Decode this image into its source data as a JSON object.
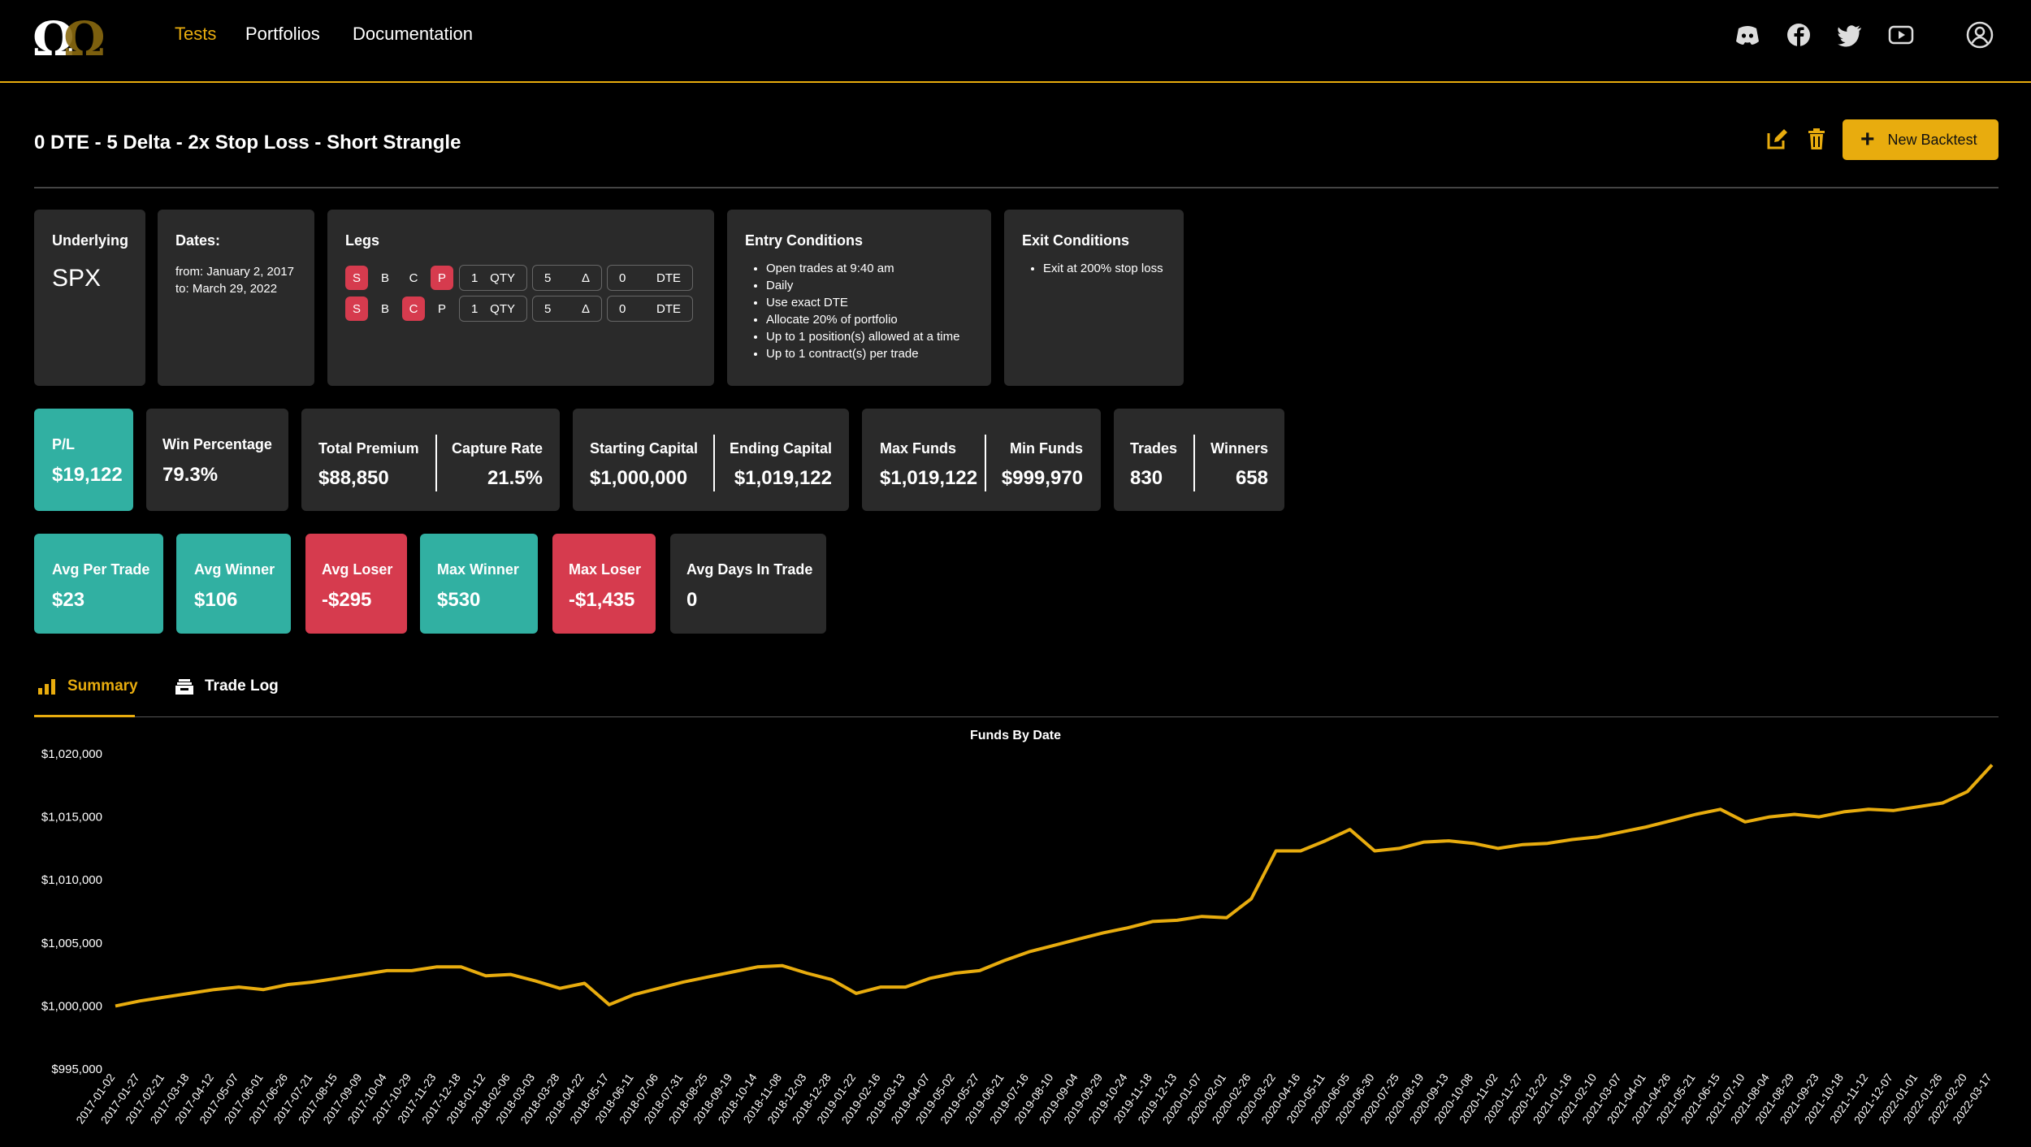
{
  "nav": {
    "links": [
      {
        "label": "Tests",
        "active": true
      },
      {
        "label": "Portfolios",
        "active": false
      },
      {
        "label": "Documentation",
        "active": false
      }
    ],
    "social_icons": [
      "discord-icon",
      "facebook-icon",
      "twitter-icon",
      "youtube-icon",
      "user-account-icon"
    ],
    "accent_color": "#e8ac0e"
  },
  "header": {
    "title": "0 DTE - 5 Delta - 2x Stop Loss - Short Strangle",
    "new_backtest_label": "New Backtest"
  },
  "info": {
    "underlying": {
      "title": "Underlying",
      "value": "SPX"
    },
    "dates": {
      "title": "Dates:",
      "from": "from: January 2, 2017",
      "to": "to: March 29, 2022"
    },
    "legs": {
      "title": "Legs",
      "rows": [
        {
          "s": "S",
          "b": "B",
          "c": "C",
          "p": "P",
          "active_side": "S",
          "active_type": "P",
          "qty": "1",
          "qty_label": "QTY",
          "delta": "5",
          "delta_label": "Δ",
          "dte": "0",
          "dte_label": "DTE"
        },
        {
          "s": "S",
          "b": "B",
          "c": "C",
          "p": "P",
          "active_side": "S",
          "active_type": "C",
          "qty": "1",
          "qty_label": "QTY",
          "delta": "5",
          "delta_label": "Δ",
          "dte": "0",
          "dte_label": "DTE"
        }
      ]
    },
    "entry": {
      "title": "Entry Conditions",
      "items": [
        "Open trades at 9:40 am",
        "Daily",
        "Use exact DTE",
        "Allocate 20% of portfolio",
        "Up to 1 position(s) allowed at a time",
        "Up to 1 contract(s) per trade"
      ]
    },
    "exit": {
      "title": "Exit Conditions",
      "items": [
        "Exit at 200% stop loss"
      ]
    }
  },
  "stats": {
    "pl": {
      "label": "P/L",
      "value": "$19,122"
    },
    "win_pct": {
      "label": "Win Percentage",
      "value": "79.3%"
    },
    "total_premium": {
      "label": "Total Premium",
      "value": "$88,850"
    },
    "capture_rate": {
      "label": "Capture Rate",
      "value": "21.5%"
    },
    "starting_capital": {
      "label": "Starting Capital",
      "value": "$1,000,000"
    },
    "ending_capital": {
      "label": "Ending Capital",
      "value": "$1,019,122"
    },
    "max_funds": {
      "label": "Max Funds",
      "value": "$1,019,122"
    },
    "min_funds": {
      "label": "Min Funds",
      "value": "$999,970"
    },
    "trades": {
      "label": "Trades",
      "value": "830"
    },
    "winners": {
      "label": "Winners",
      "value": "658"
    },
    "avg_per_trade": {
      "label": "Avg Per Trade",
      "value": "$23"
    },
    "avg_winner": {
      "label": "Avg Winner",
      "value": "$106"
    },
    "avg_loser": {
      "label": "Avg Loser",
      "value": "-$295"
    },
    "max_winner": {
      "label": "Max Winner",
      "value": "$530"
    },
    "max_loser": {
      "label": "Max Loser",
      "value": "-$1,435"
    },
    "avg_days": {
      "label": "Avg Days In Trade",
      "value": "0"
    },
    "colors": {
      "positive": "#31b0a2",
      "negative": "#d63b4e",
      "neutral": "#2a2a2a"
    }
  },
  "tabs": [
    {
      "label": "Summary",
      "icon": "bar-chart-icon",
      "active": true
    },
    {
      "label": "Trade Log",
      "icon": "inbox-tray-icon",
      "active": false
    }
  ],
  "chart_data": {
    "type": "line",
    "title": "Funds By Date",
    "xlabel": "",
    "ylabel": "",
    "ylim": [
      995000,
      1020000
    ],
    "y_ticks": [
      "$1,020,000",
      "$1,015,000",
      "$1,010,000",
      "$1,005,000",
      "$1,000,000",
      "$995,000"
    ],
    "y_tick_values": [
      1020000,
      1015000,
      1010000,
      1005000,
      1000000,
      995000
    ],
    "x_ticks": [
      "2017-01-02",
      "2017-01-27",
      "2017-02-21",
      "2017-03-18",
      "2017-04-12",
      "2017-05-07",
      "2017-06-01",
      "2017-06-26",
      "2017-07-21",
      "2017-08-15",
      "2017-09-09",
      "2017-10-04",
      "2017-10-29",
      "2017-11-23",
      "2017-12-18",
      "2018-01-12",
      "2018-02-06",
      "2018-03-03",
      "2018-03-28",
      "2018-04-22",
      "2018-05-17",
      "2018-06-11",
      "2018-07-06",
      "2018-07-31",
      "2018-08-25",
      "2018-09-19",
      "2018-10-14",
      "2018-11-08",
      "2018-12-03",
      "2018-12-28",
      "2019-01-22",
      "2019-02-16",
      "2019-03-13",
      "2019-04-07",
      "2019-05-02",
      "2019-05-27",
      "2019-06-21",
      "2019-07-16",
      "2019-08-10",
      "2019-09-04",
      "2019-09-29",
      "2019-10-24",
      "2019-11-18",
      "2019-12-13",
      "2020-01-07",
      "2020-02-01",
      "2020-02-26",
      "2020-03-22",
      "2020-04-16",
      "2020-05-11",
      "2020-06-05",
      "2020-06-30",
      "2020-07-25",
      "2020-08-19",
      "2020-09-13",
      "2020-10-08",
      "2020-11-02",
      "2020-11-27",
      "2020-12-22",
      "2021-01-16",
      "2021-02-10",
      "2021-03-07",
      "2021-04-01",
      "2021-04-26",
      "2021-05-21",
      "2021-06-15",
      "2021-07-10",
      "2021-08-04",
      "2021-08-29",
      "2021-09-23",
      "2021-10-18",
      "2021-11-12",
      "2021-12-07",
      "2022-01-01",
      "2022-01-26",
      "2022-02-20",
      "2022-03-17"
    ],
    "series": [
      {
        "color": "#e8ac0e",
        "values": [
          1000000,
          1000400,
          1000700,
          1001000,
          1001300,
          1001500,
          1001300,
          1001700,
          1001900,
          1002200,
          1002500,
          1002800,
          1002800,
          1003100,
          1003100,
          1002400,
          1002500,
          1002000,
          1001400,
          1001800,
          1000100,
          1000900,
          1001400,
          1001900,
          1002300,
          1002700,
          1003100,
          1003200,
          1002600,
          1002100,
          1001000,
          1001500,
          1001500,
          1002200,
          1002600,
          1002800,
          1003600,
          1004300,
          1004800,
          1005300,
          1005800,
          1006200,
          1006700,
          1006800,
          1007100,
          1007000,
          1008500,
          1012300,
          1012300,
          1013100,
          1014000,
          1012300,
          1012500,
          1013000,
          1013100,
          1012900,
          1012500,
          1012800,
          1012900,
          1013200,
          1013400,
          1013800,
          1014200,
          1014700,
          1015200,
          1015600,
          1014600,
          1015000,
          1015200,
          1015000,
          1015400,
          1015600,
          1015500,
          1015800,
          1016100,
          1017000,
          1019122
        ]
      }
    ]
  }
}
